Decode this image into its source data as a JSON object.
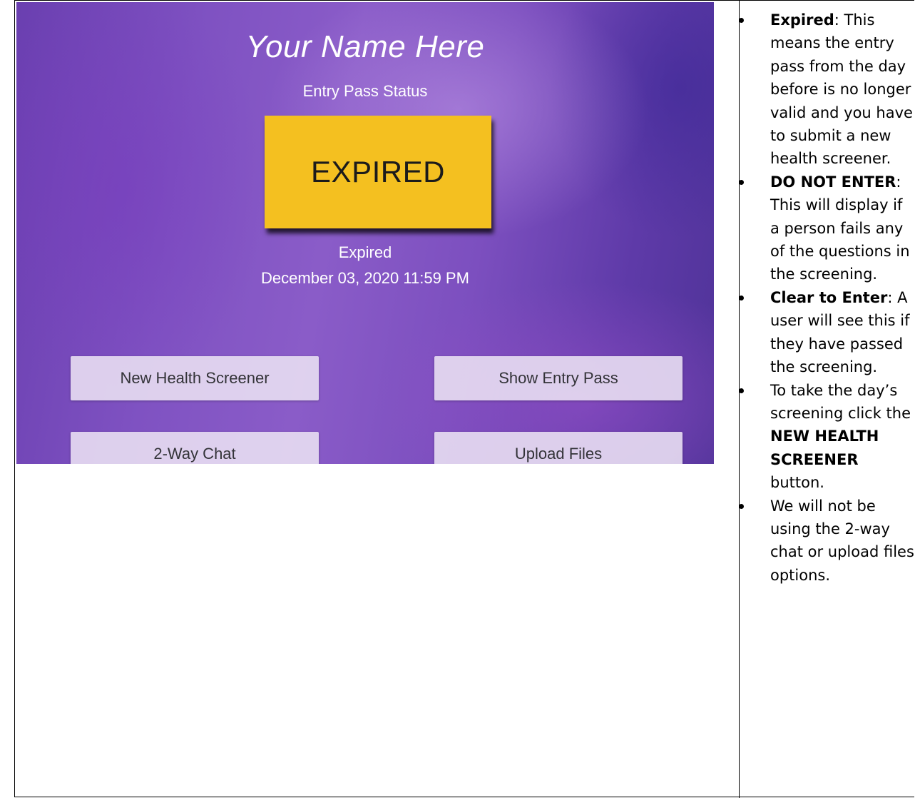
{
  "screen": {
    "name": "Your Name Here",
    "status_label": "Entry Pass Status",
    "status_badge": "EXPIRED",
    "status_text": "Expired",
    "status_date": "December 03, 2020 11:59 PM",
    "buttons": {
      "new_health_screener": "New Health Screener",
      "show_entry_pass": "Show Entry Pass",
      "two_way_chat": "2-Way Chat",
      "upload_files": "Upload Files"
    },
    "colors": {
      "badge_expired": "#f4c020",
      "background_purple": "#7f52c2",
      "button_fill": "#e8def2"
    }
  },
  "notes": {
    "expired": {
      "term": "Expired",
      "sep": ": ",
      "text": "This means the entry pass from the day before is no longer valid and you have to submit a new health screener."
    },
    "do_not_enter": {
      "term": "DO NOT ENTER",
      "sep": ": ",
      "text": "This will display if a person fails any of the questions in the screening."
    },
    "clear_to_enter": {
      "term": "Clear to Enter",
      "sep": ": ",
      "text": "A user will see this if they have passed the screening."
    },
    "take_screening": {
      "before": "To take the day’s screening click the ",
      "bold": "NEW HEALTH SCREENER",
      "after": " button."
    },
    "not_using": {
      "text": "We will not be using the 2-way chat or upload files options."
    }
  }
}
